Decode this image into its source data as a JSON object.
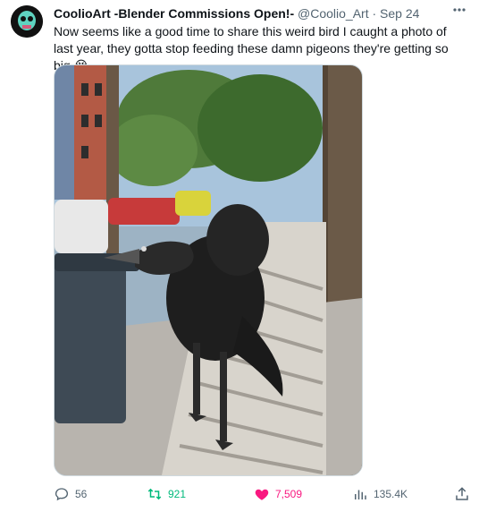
{
  "author": {
    "name": "CoolioArt -Blender Commissions Open!-",
    "handle": "@Coolio_Art",
    "separator": "·",
    "date": "Sep 24"
  },
  "tweet": {
    "text": "Now seems like a good time to share this weird bird I caught a photo of last year, they gotta stop feeding these damn pigeons they're getting so big",
    "emoji": "😭"
  },
  "media": {
    "alt_icon": "photo"
  },
  "actions": {
    "replies": "56",
    "retweets": "921",
    "likes": "7,509",
    "views": "135.4K"
  },
  "colors": {
    "retweet": "#00ba7c",
    "like": "#f91880",
    "muted": "#536471"
  }
}
